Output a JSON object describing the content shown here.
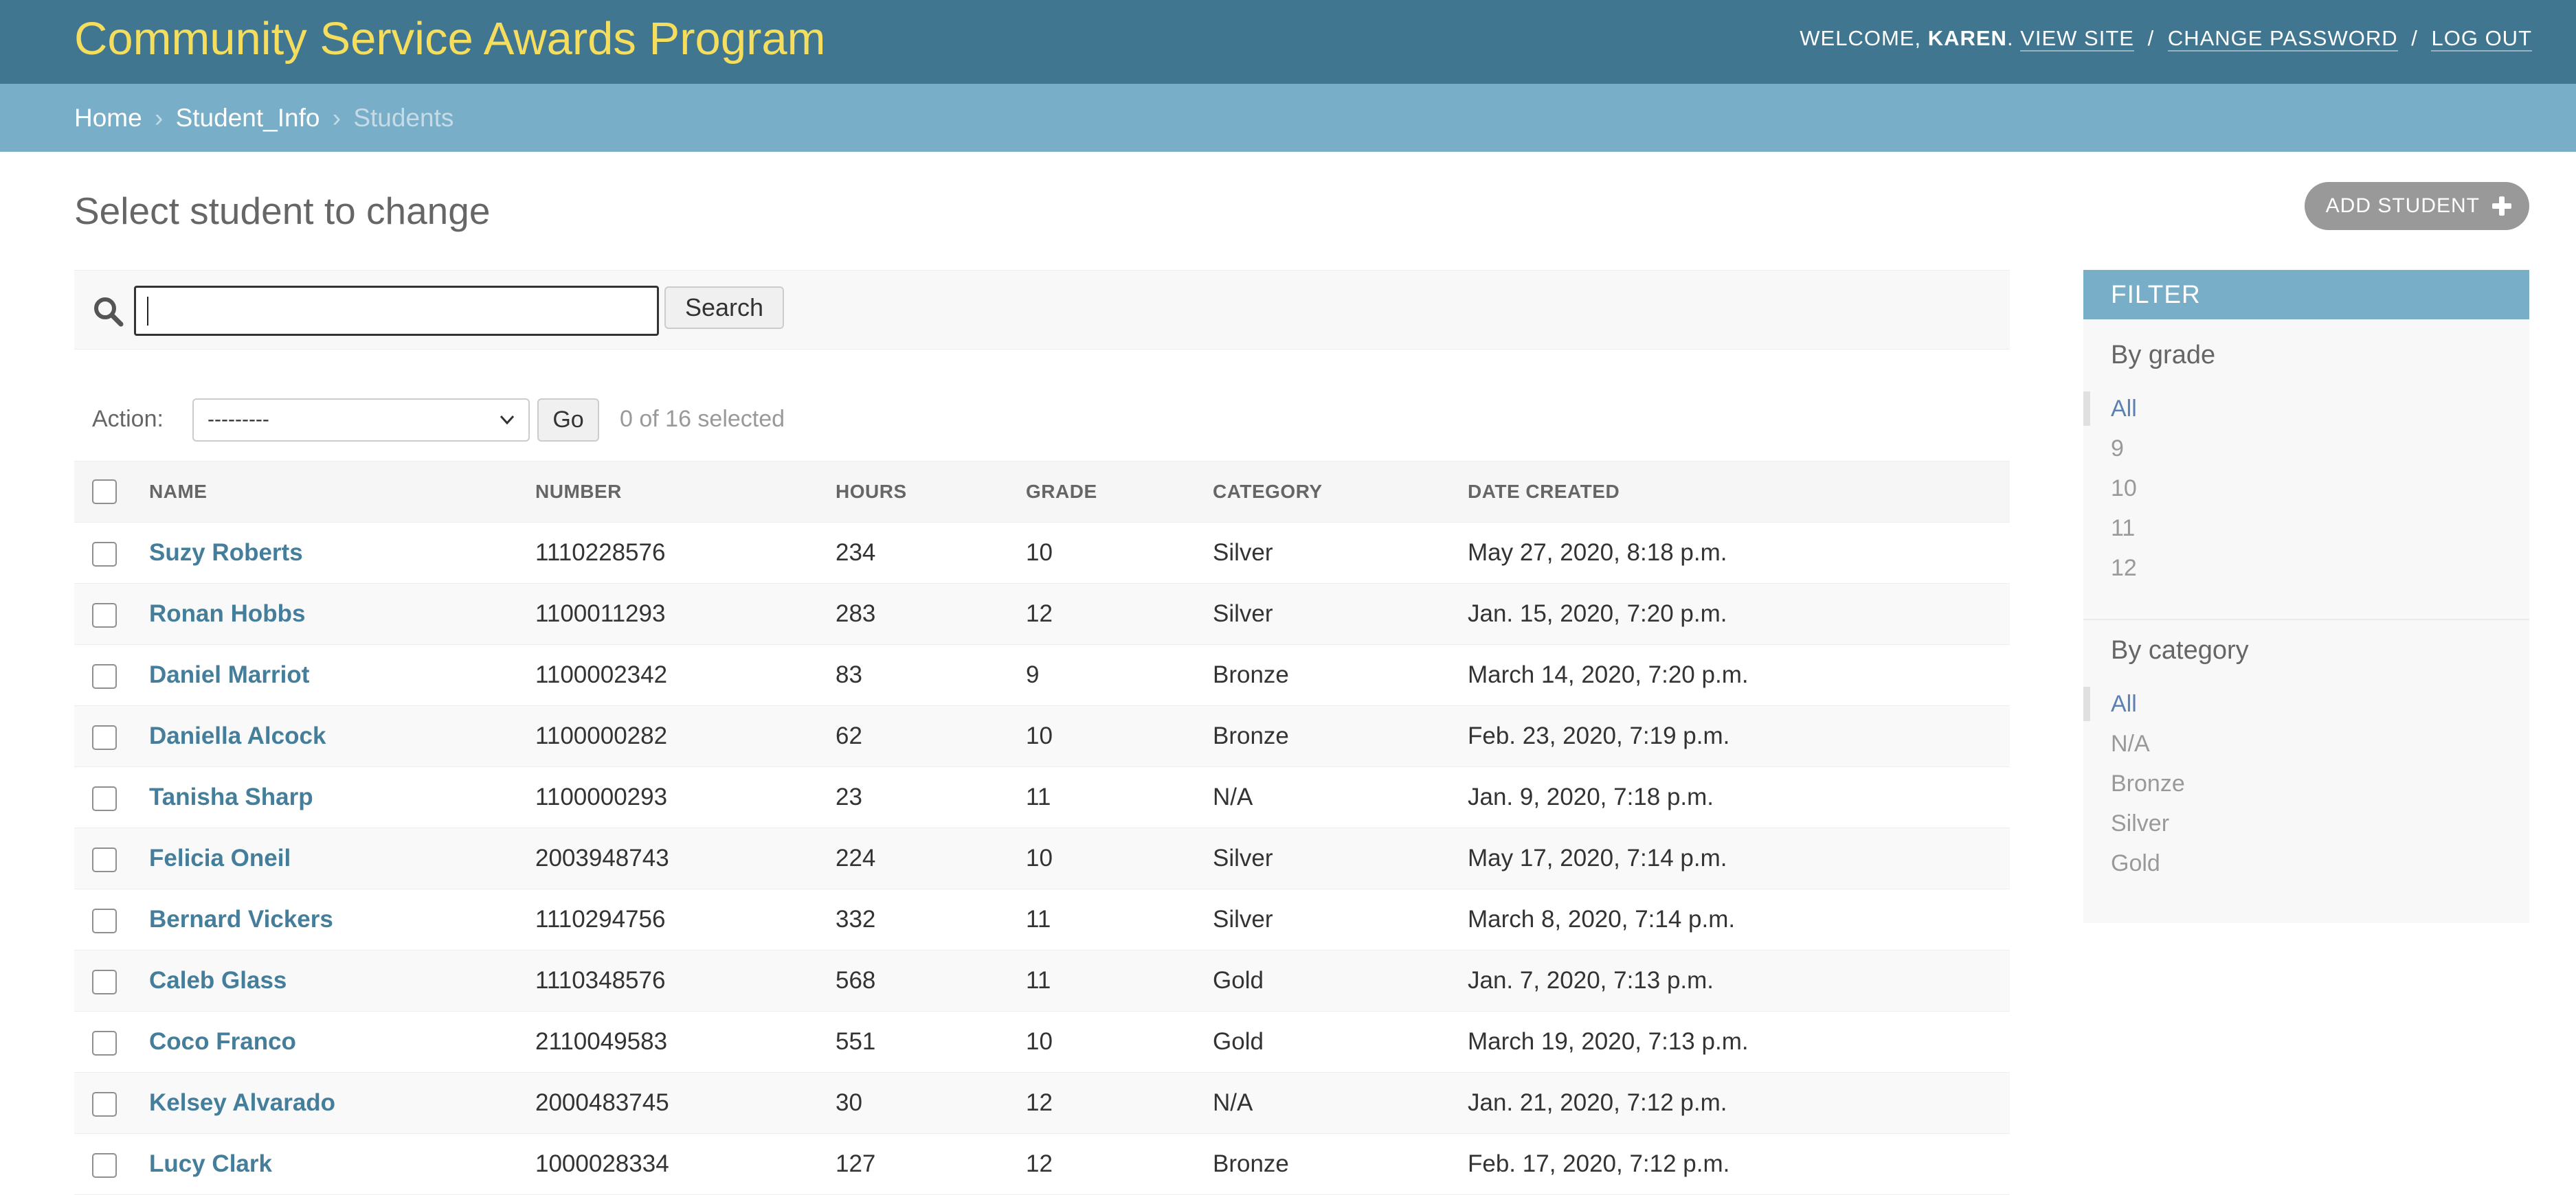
{
  "header": {
    "title": "Community Service Awards Program",
    "welcome": "WELCOME,",
    "username": "KAREN",
    "links": {
      "view_site": "VIEW SITE",
      "change_password": "CHANGE PASSWORD",
      "log_out": "LOG OUT"
    },
    "separator": "/"
  },
  "breadcrumbs": {
    "home": "Home",
    "app": "Student_Info",
    "current": "Students",
    "separator": "›"
  },
  "page": {
    "title": "Select student to change",
    "add_button": "ADD STUDENT"
  },
  "search": {
    "value": "",
    "button": "Search"
  },
  "actions": {
    "label": "Action:",
    "selected_option": "---------",
    "go": "Go",
    "selected_count": "0 of 16 selected"
  },
  "table": {
    "columns": [
      "NAME",
      "NUMBER",
      "HOURS",
      "GRADE",
      "CATEGORY",
      "DATE CREATED"
    ],
    "rows": [
      {
        "name": "Suzy Roberts",
        "number": "1110228576",
        "hours": "234",
        "grade": "10",
        "category": "Silver",
        "date": "May 27, 2020, 8:18 p.m."
      },
      {
        "name": "Ronan Hobbs",
        "number": "1100011293",
        "hours": "283",
        "grade": "12",
        "category": "Silver",
        "date": "Jan. 15, 2020, 7:20 p.m."
      },
      {
        "name": "Daniel Marriot",
        "number": "1100002342",
        "hours": "83",
        "grade": "9",
        "category": "Bronze",
        "date": "March 14, 2020, 7:20 p.m."
      },
      {
        "name": "Daniella Alcock",
        "number": "1100000282",
        "hours": "62",
        "grade": "10",
        "category": "Bronze",
        "date": "Feb. 23, 2020, 7:19 p.m."
      },
      {
        "name": "Tanisha Sharp",
        "number": "1100000293",
        "hours": "23",
        "grade": "11",
        "category": "N/A",
        "date": "Jan. 9, 2020, 7:18 p.m."
      },
      {
        "name": "Felicia Oneil",
        "number": "2003948743",
        "hours": "224",
        "grade": "10",
        "category": "Silver",
        "date": "May 17, 2020, 7:14 p.m."
      },
      {
        "name": "Bernard Vickers",
        "number": "1110294756",
        "hours": "332",
        "grade": "11",
        "category": "Silver",
        "date": "March 8, 2020, 7:14 p.m."
      },
      {
        "name": "Caleb Glass",
        "number": "1110348576",
        "hours": "568",
        "grade": "11",
        "category": "Gold",
        "date": "Jan. 7, 2020, 7:13 p.m."
      },
      {
        "name": "Coco Franco",
        "number": "2110049583",
        "hours": "551",
        "grade": "10",
        "category": "Gold",
        "date": "March 19, 2020, 7:13 p.m."
      },
      {
        "name": "Kelsey Alvarado",
        "number": "2000483745",
        "hours": "30",
        "grade": "12",
        "category": "N/A",
        "date": "Jan. 21, 2020, 7:12 p.m."
      },
      {
        "name": "Lucy Clark",
        "number": "1000028334",
        "hours": "127",
        "grade": "12",
        "category": "Bronze",
        "date": "Feb. 17, 2020, 7:12 p.m."
      }
    ]
  },
  "filter": {
    "heading": "FILTER",
    "groups": [
      {
        "title": "By grade",
        "options": [
          "All",
          "9",
          "10",
          "11",
          "12"
        ],
        "selected": "All"
      },
      {
        "title": "By category",
        "options": [
          "All",
          "N/A",
          "Bronze",
          "Silver",
          "Gold"
        ],
        "selected": "All"
      }
    ]
  },
  "colors": {
    "header_bg": "#417690",
    "branding": "#f5dd5d",
    "breadcrumb_bg": "#79aec8",
    "link": "#447e9b",
    "filter_selected": "#5b80b2",
    "button_grey": "#999999"
  },
  "icons": {
    "search": "search-icon",
    "add": "plus-icon",
    "select_caret": "chevron-down-icon"
  }
}
